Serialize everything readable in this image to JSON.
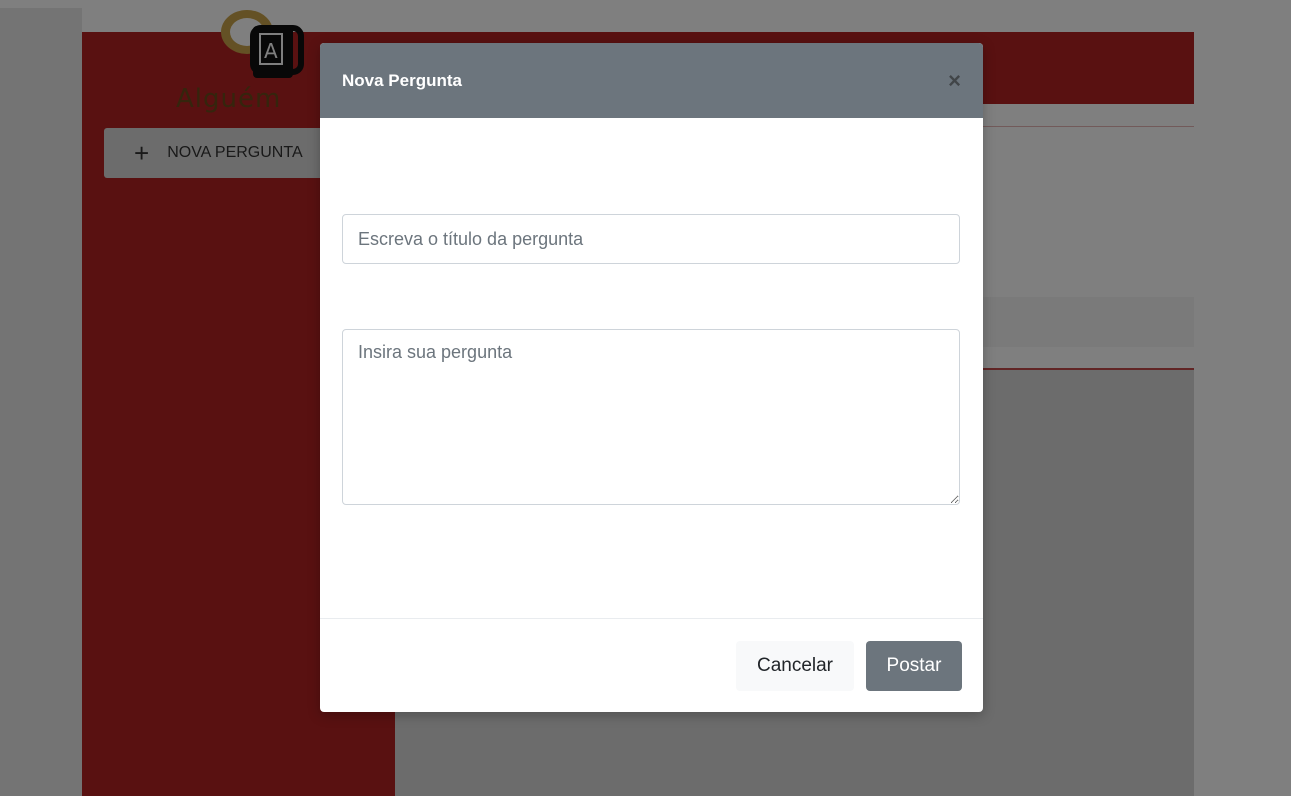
{
  "app": {
    "logo_letter": "A",
    "logo_text": "Alguém",
    "new_question_label": "NOVA PERGUNTA",
    "plus_symbol": "+"
  },
  "colors": {
    "brand_red": "#b22222",
    "modal_header": "#6c757d",
    "post_button": "#6c757d"
  },
  "modal": {
    "title": "Nova Pergunta",
    "close_symbol": "×",
    "title_placeholder": "Escreva o título da pergunta",
    "question_placeholder": "Insira sua pergunta",
    "cancel_label": "Cancelar",
    "post_label": "Postar"
  }
}
